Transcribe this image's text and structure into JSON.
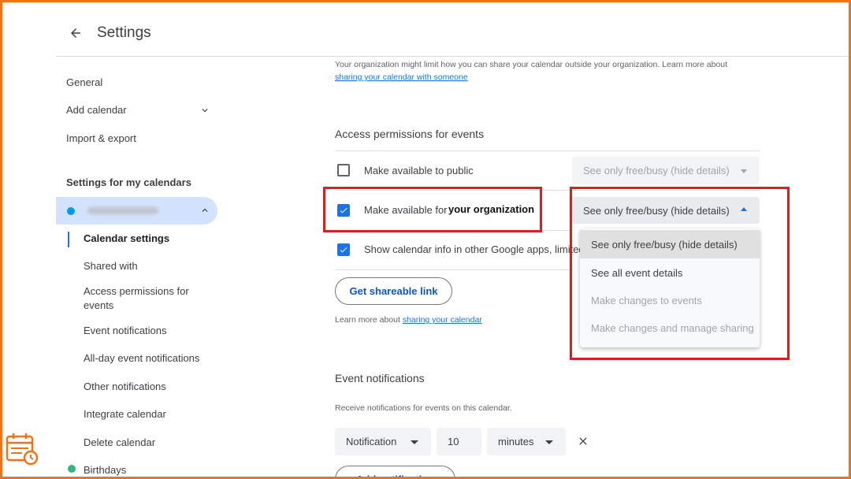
{
  "header": {
    "title": "Settings"
  },
  "sidebar": {
    "items": [
      {
        "label": "General"
      },
      {
        "label": "Add calendar"
      },
      {
        "label": "Import & export"
      }
    ],
    "section_title": "Settings for my calendars",
    "calendar_sub_items": [
      {
        "label": "Calendar settings"
      },
      {
        "label": "Shared with"
      },
      {
        "label": "Access permissions for events"
      },
      {
        "label": "Event notifications"
      },
      {
        "label": "All-day event notifications"
      },
      {
        "label": "Other notifications"
      },
      {
        "label": "Integrate calendar"
      },
      {
        "label": "Delete calendar"
      }
    ],
    "birthdays_label": "Birthdays"
  },
  "main": {
    "intro_note": "Your organization might limit how you can share your calendar outside your organization. Learn more about",
    "intro_link": "sharing your calendar with someone",
    "access_title": "Access permissions for events",
    "rows": [
      {
        "label": "Make available to public",
        "checked": false,
        "select_value": "See only free/busy (hide details)"
      },
      {
        "label": "Make available for",
        "overlay": "your organization",
        "checked": true,
        "select_value": "See only free/busy (hide details)"
      },
      {
        "label": "Show calendar info in other Google apps, limited",
        "checked": true
      }
    ],
    "dropdown_options": [
      {
        "label": "See only free/busy (hide details)",
        "state": "selected"
      },
      {
        "label": "See all event details",
        "state": "enabled"
      },
      {
        "label": "Make changes to events",
        "state": "disabled"
      },
      {
        "label": "Make changes and manage sharing",
        "state": "disabled"
      }
    ],
    "shareable_button": "Get shareable link",
    "learn_more_text": "Learn more about",
    "learn_more_link": "sharing your calendar",
    "notifications_title": "Event notifications",
    "notifications_desc": "Receive notifications for events on this calendar.",
    "notification": {
      "type": "Notification",
      "amount": "10",
      "unit": "minutes"
    },
    "add_notification": "Add notification"
  },
  "colors": {
    "accent": "#1a73e8",
    "highlight_box": "#e21c1c",
    "frame": "#f47216",
    "selected_nav": "#d3e3fd"
  }
}
